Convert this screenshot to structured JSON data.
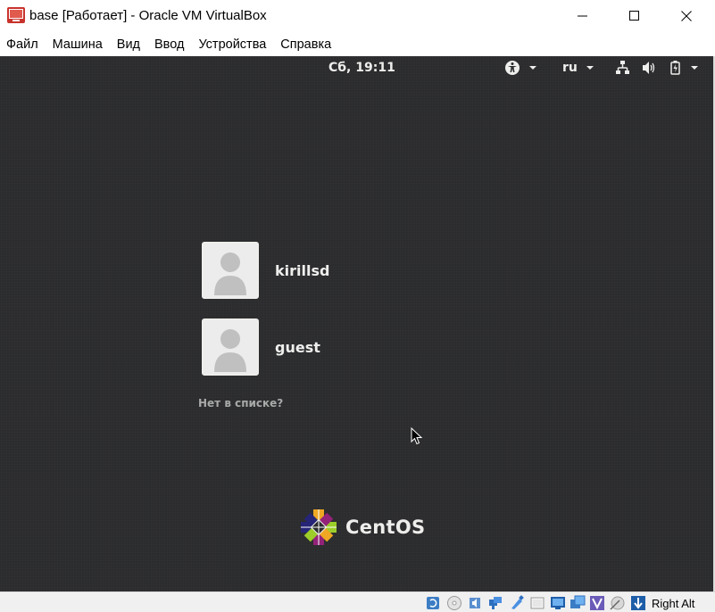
{
  "window": {
    "title": "base [Работает] - Oracle VM VirtualBox"
  },
  "menu": {
    "items": [
      "Файл",
      "Машина",
      "Вид",
      "Ввод",
      "Устройства",
      "Справка"
    ]
  },
  "gnome": {
    "clock": "Сб, 19:11",
    "language": "ru",
    "icons": [
      "accessibility-icon",
      "network-icon",
      "volume-icon",
      "battery-icon",
      "power-menu-icon"
    ]
  },
  "login": {
    "users": [
      {
        "name": "kirillsd"
      },
      {
        "name": "guest"
      }
    ],
    "not_listed_label": "Нет в списке?"
  },
  "branding": {
    "logo_text": "CentOS"
  },
  "statusbar": {
    "host_key": "Right Alt",
    "icons": [
      "hard-disk-icon",
      "optical-disk-icon",
      "audio-icon",
      "network-adapter-icon",
      "usb-icon",
      "shared-folders-icon",
      "display-icon",
      "video-capture-icon",
      "virtualization-icon",
      "mouse-integration-icon",
      "keyboard-capture-icon"
    ]
  },
  "colors": {
    "vm_background": "#2b2c2e",
    "text_light": "#eeeeec",
    "text_dim": "#a8a9a8"
  }
}
